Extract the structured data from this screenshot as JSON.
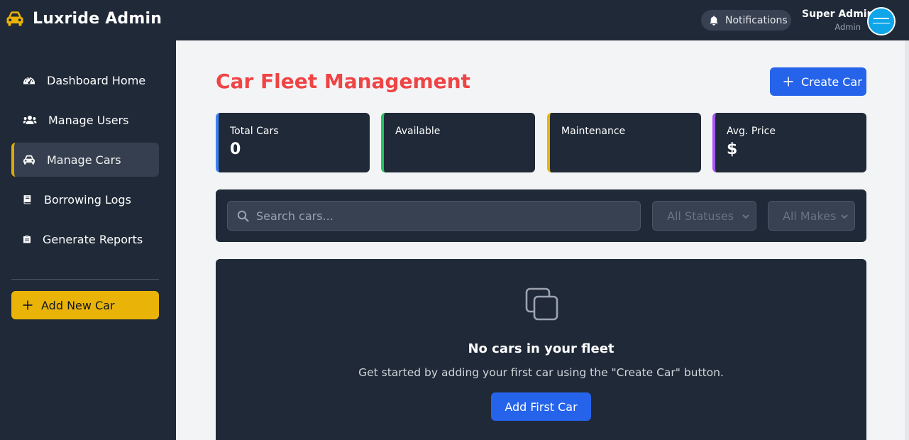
{
  "app": {
    "title": "Luxride Admin"
  },
  "header": {
    "notifications_label": "Notifications",
    "user_name": "Super Admin",
    "user_role": "Admin"
  },
  "sidebar": {
    "items": [
      {
        "label": "Dashboard Home",
        "icon": "gauge-icon",
        "active": false
      },
      {
        "label": "Manage Users",
        "icon": "users-icon",
        "active": false
      },
      {
        "label": "Manage Cars",
        "icon": "car-icon",
        "active": true
      },
      {
        "label": "Borrowing Logs",
        "icon": "book-icon",
        "active": false
      },
      {
        "label": "Generate Reports",
        "icon": "clipboard-icon",
        "active": false
      }
    ],
    "add_button_label": "Add New Car"
  },
  "main": {
    "page_title": "Car Fleet Management",
    "create_button_label": "Create Car",
    "stats": [
      {
        "label": "Total Cars",
        "value": "0",
        "accent": "#3b82f6"
      },
      {
        "label": "Available",
        "value": "",
        "accent": "#22c55e"
      },
      {
        "label": "Maintenance",
        "value": "",
        "accent": "#eab308"
      },
      {
        "label": "Avg. Price",
        "value": "$",
        "accent": "#a855f7"
      }
    ],
    "filters": {
      "search_placeholder": "Search cars...",
      "status_selected": "All Statuses",
      "make_selected": "All Makes"
    },
    "empty_state": {
      "title": "No cars in your fleet",
      "text": "Get started by adding your first car using the \"Create Car\" button.",
      "button_label": "Add First Car"
    }
  },
  "colors": {
    "title_red": "#ef4444",
    "primary_blue": "#2563eb",
    "accent_yellow": "#eab308",
    "panel_dark": "#1f2937"
  }
}
